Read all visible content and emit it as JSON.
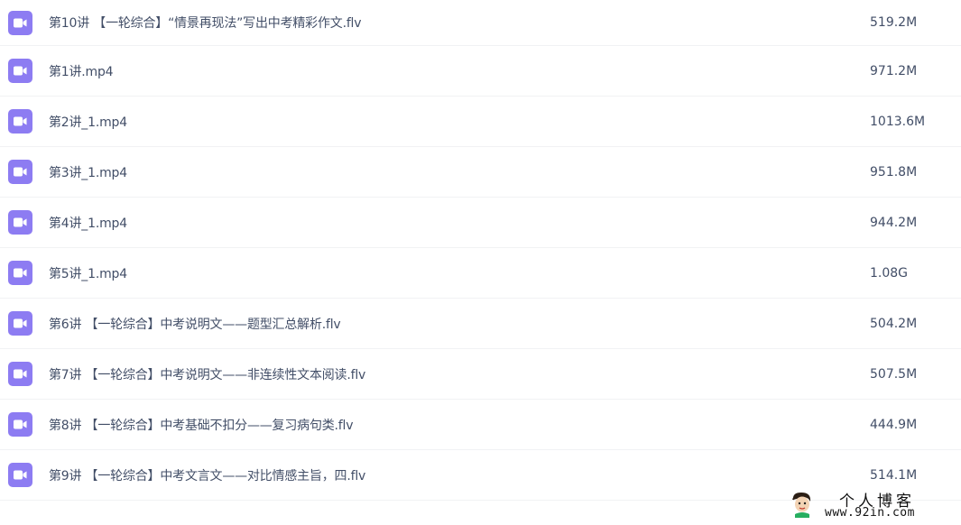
{
  "files": [
    {
      "name": "第10讲 【一轮综合】“情景再现法”写出中考精彩作文.flv",
      "size": "519.2M",
      "icon": "video-icon"
    },
    {
      "name": "第1讲.mp4",
      "size": "971.2M",
      "icon": "video-icon"
    },
    {
      "name": "第2讲_1.mp4",
      "size": "1013.6M",
      "icon": "video-icon"
    },
    {
      "name": "第3讲_1.mp4",
      "size": "951.8M",
      "icon": "video-icon"
    },
    {
      "name": "第4讲_1.mp4",
      "size": "944.2M",
      "icon": "video-icon"
    },
    {
      "name": "第5讲_1.mp4",
      "size": "1.08G",
      "icon": "video-icon"
    },
    {
      "name": "第6讲 【一轮综合】中考说明文——题型汇总解析.flv",
      "size": "504.2M",
      "icon": "video-icon"
    },
    {
      "name": "第7讲 【一轮综合】中考说明文——非连续性文本阅读.flv",
      "size": "507.5M",
      "icon": "video-icon"
    },
    {
      "name": "第8讲 【一轮综合】中考基础不扣分——复习病句类.flv",
      "size": "444.9M",
      "icon": "video-icon"
    },
    {
      "name": "第9讲 【一轮综合】中考文言文——对比情感主旨，四.flv",
      "size": "514.1M",
      "icon": "video-icon"
    }
  ],
  "watermark": {
    "title": "个人博客",
    "url": "www.92in.com"
  },
  "colors": {
    "icon_bg": "#8d7cf2",
    "text": "#424e67",
    "divider": "#f1f2f4"
  }
}
